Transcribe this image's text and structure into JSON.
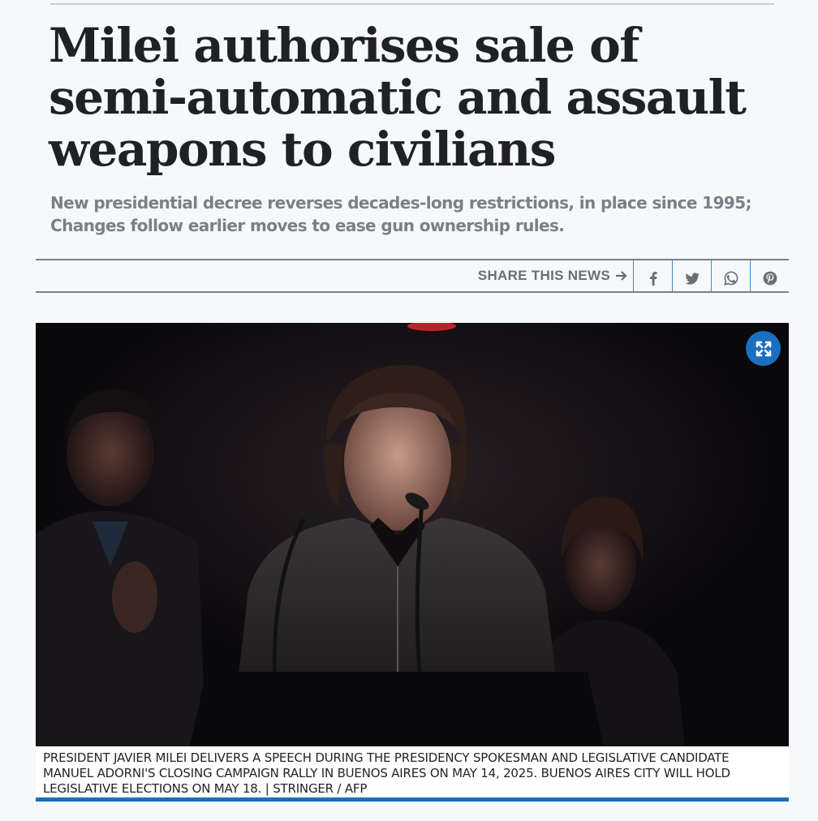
{
  "article": {
    "headline": "Milei authorises sale of semi-automatic and assault weapons to civilians",
    "subheadline": "New presidential decree reverses decades-long restrictions, in place since 1995; Changes follow earlier moves to ease gun ownership rules."
  },
  "share": {
    "label": "SHARE THIS NEWS",
    "arrow_icon": "arrow-right-icon",
    "buttons": [
      {
        "name": "facebook",
        "icon": "facebook-icon"
      },
      {
        "name": "twitter",
        "icon": "twitter-icon"
      },
      {
        "name": "whatsapp",
        "icon": "whatsapp-icon"
      },
      {
        "name": "pinterest",
        "icon": "pinterest-icon"
      }
    ]
  },
  "photo": {
    "expand_icon": "expand-icon",
    "caption": "PRESIDENT JAVIER MILEI DELIVERS A SPEECH DURING THE PRESIDENCY SPOKESMAN AND LEGISLATIVE CANDIDATE MANUEL ADORNI'S CLOSING CAMPAIGN RALLY IN BUENOS AIRES ON MAY 14, 2025. BUENOS AIRES CITY WILL HOLD LEGISLATIVE ELECTIONS ON MAY 18. | STRINGER / AFP"
  },
  "colors": {
    "accent": "#1a6fc0",
    "headline": "#1f2126",
    "subheadline": "#7b7f87",
    "background": "#f7f8fa"
  }
}
